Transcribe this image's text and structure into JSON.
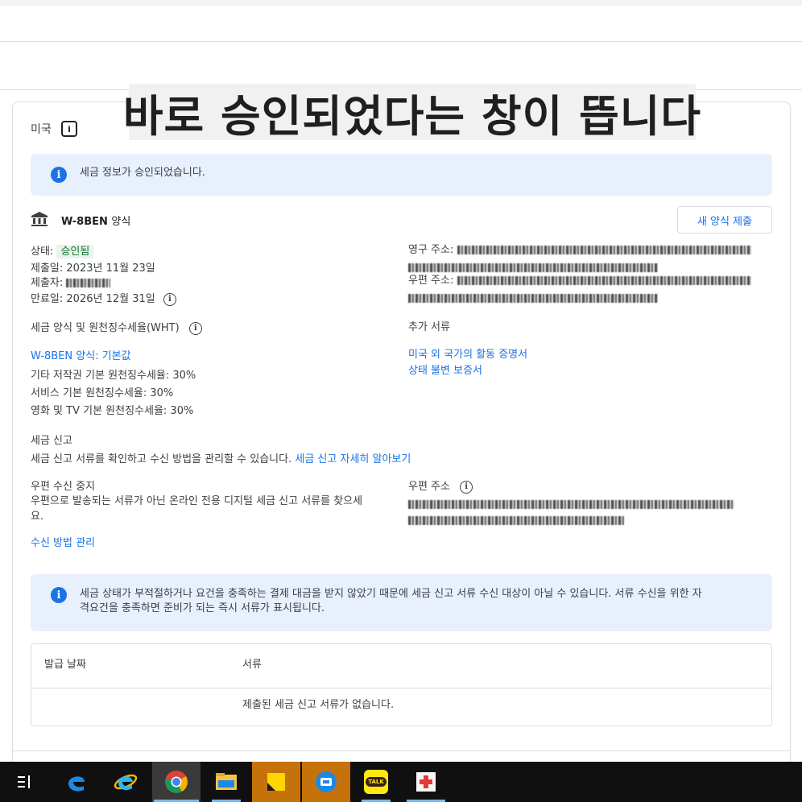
{
  "overlay_title": "바로 승인되었다는 창이 뜹니다",
  "country": "미국",
  "banner_approved": "세금 정보가 승인되었습니다.",
  "form": {
    "title": "W-8BEN",
    "title_suffix": "양식",
    "new_form_button": "새 양식 제출",
    "status_label": "상태:",
    "status_value": "승인됨",
    "submitted_label": "제출일:",
    "submitted_value": "2023년 11월 23일",
    "submitter_label": "제출자:",
    "expiry_label": "만료일:",
    "expiry_value": "2026년 12월 31일",
    "permanent_address_label": "영구 주소:",
    "mailing_address_label": "우편 주소:"
  },
  "tax_section": {
    "heading": "세금 양식 및 원천징수세율(WHT)",
    "form_link": "W-8BEN 양식: 기본값",
    "rates": [
      "기타 저작권 기본 원천징수세율: 30%",
      "서비스 기본 원천징수세율: 30%",
      "영화 및 TV 기본 원천징수세율: 30%"
    ],
    "extra_docs_heading": "추가 서류",
    "extra_docs_links": [
      "미국 외 국가의 활동 증명서",
      "상태 불변 보증서"
    ]
  },
  "tax_report": {
    "heading": "세금 신고",
    "description": "세금 신고 서류를 확인하고 수신 방법을 관리할 수 있습니다.",
    "learn_more": "세금 신고 자세히 알아보기",
    "mail_stop_heading": "우편 수신 중지",
    "mail_stop_line1": "우편으로 발송되는 서류가 아닌 온라인 전용 디지털 세금 신고 서류를 찾으세",
    "mail_stop_line2": "요.",
    "mail_address_label": "우편 주소",
    "manage_link": "수신 방법 관리"
  },
  "banner_notice_line1": "세금 상태가 부적절하거나 요건을 충족하는 결제 대금을 받지 않았기 때문에 세금 신고 서류 수신 대상이 아닐 수 있습니다. 서류 수신을 위한 자",
  "banner_notice_line2": "격요건을 충족하면 준비가 되는 즉시 서류가 표시됩니다.",
  "table": {
    "col_date": "발급 날짜",
    "col_doc": "서류",
    "empty_text": "제출된 세금 신고 서류가 없습니다."
  },
  "taskbar": {
    "kakao_label": "TALK"
  },
  "colors": {
    "accent": "#1a73e8",
    "banner_bg": "#e8f0fe",
    "status_green_bg": "#e6f4ea",
    "status_green_text": "#137333"
  }
}
